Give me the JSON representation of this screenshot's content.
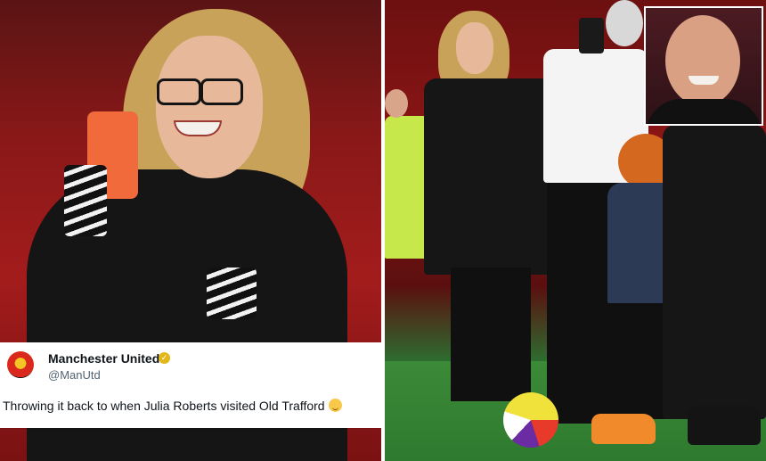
{
  "tweet": {
    "display_name": "Manchester United",
    "handle": "@ManUtd",
    "text": "Throwing it back to when Julia Roberts visited Old Trafford"
  },
  "colors": {
    "stadium_red": "#a31c1c",
    "pitch_green": "#3b8a38",
    "verified_gold": "#e2b719",
    "phone_orange": "#f06a3b"
  },
  "icons": {
    "club_crest": "manchester-united-crest",
    "verified": "verified-badge-icon",
    "emoji": "relieved-face-emoji"
  }
}
